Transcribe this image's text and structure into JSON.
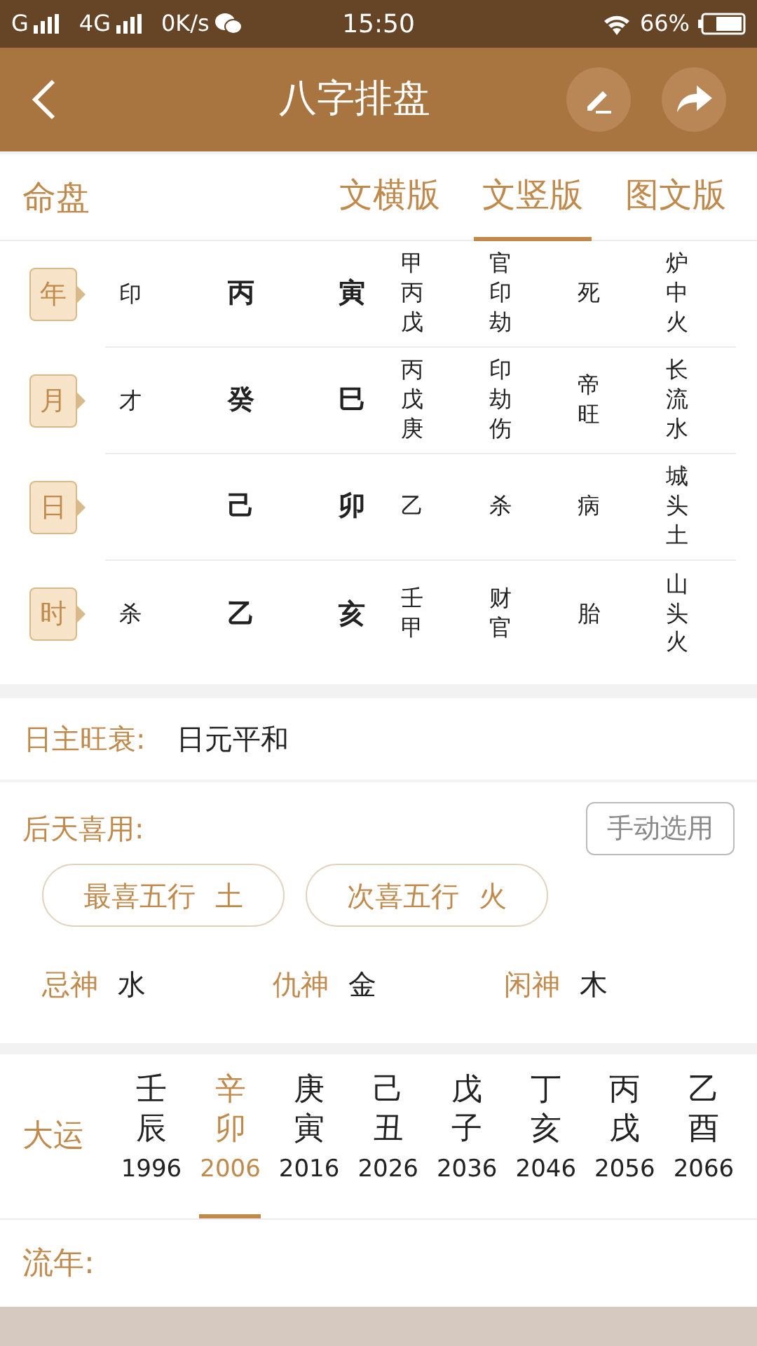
{
  "status_bar": {
    "network_1": "G",
    "network_2": "4G",
    "speed": "0K/s",
    "time": "15:50",
    "battery": "66%"
  },
  "header": {
    "title": "八字排盘"
  },
  "chart_tabs": {
    "label": "命盘",
    "items": [
      {
        "label": "文横版",
        "selected": false
      },
      {
        "label": "文竖版",
        "selected": true
      },
      {
        "label": "图文版",
        "selected": false
      }
    ]
  },
  "pillars": [
    {
      "label": "年",
      "ten_god": "印",
      "stem": "丙",
      "branch": "寅",
      "hidden_stems": "甲丙戊",
      "hidden_gods": "官印劫",
      "stage": "死",
      "nayin": "炉中火"
    },
    {
      "label": "月",
      "ten_god": "才",
      "stem": "癸",
      "branch": "巳",
      "hidden_stems": "丙戊庚",
      "hidden_gods": "印劫伤",
      "stage": "帝旺",
      "nayin": "长流水"
    },
    {
      "label": "日",
      "stem": "己",
      "branch": "卯",
      "hidden_stems": "乙",
      "hidden_gods": "杀",
      "stage": "病",
      "nayin": "城头土"
    },
    {
      "label": "时",
      "ten_god": "杀",
      "stem": "乙",
      "branch": "亥",
      "hidden_stems": "壬甲",
      "hidden_gods": "财官",
      "stage": "胎",
      "nayin": "山头火"
    }
  ],
  "strength": {
    "label": "日主旺衰:",
    "value": "日元平和"
  },
  "favorable": {
    "label": "后天喜用:",
    "button": "手动选用",
    "chips": [
      {
        "label": "最喜五行",
        "value": "土"
      },
      {
        "label": "次喜五行",
        "value": "火"
      }
    ],
    "gods": [
      {
        "label": "忌神",
        "value": "水"
      },
      {
        "label": "仇神",
        "value": "金"
      },
      {
        "label": "闲神",
        "value": "木"
      }
    ]
  },
  "dayun": {
    "label": "大运",
    "items": [
      {
        "stem": "壬",
        "branch": "辰",
        "year": "1996",
        "selected": false
      },
      {
        "stem": "辛",
        "branch": "卯",
        "year": "2006",
        "selected": true
      },
      {
        "stem": "庚",
        "branch": "寅",
        "year": "2016",
        "selected": false
      },
      {
        "stem": "己",
        "branch": "丑",
        "year": "2026",
        "selected": false
      },
      {
        "stem": "戊",
        "branch": "子",
        "year": "2036",
        "selected": false
      },
      {
        "stem": "丁",
        "branch": "亥",
        "year": "2046",
        "selected": false
      },
      {
        "stem": "丙",
        "branch": "戌",
        "year": "2056",
        "selected": false
      },
      {
        "stem": "乙",
        "branch": "酉",
        "year": "2066",
        "selected": false
      }
    ]
  },
  "liunian": {
    "label": "流年:"
  }
}
